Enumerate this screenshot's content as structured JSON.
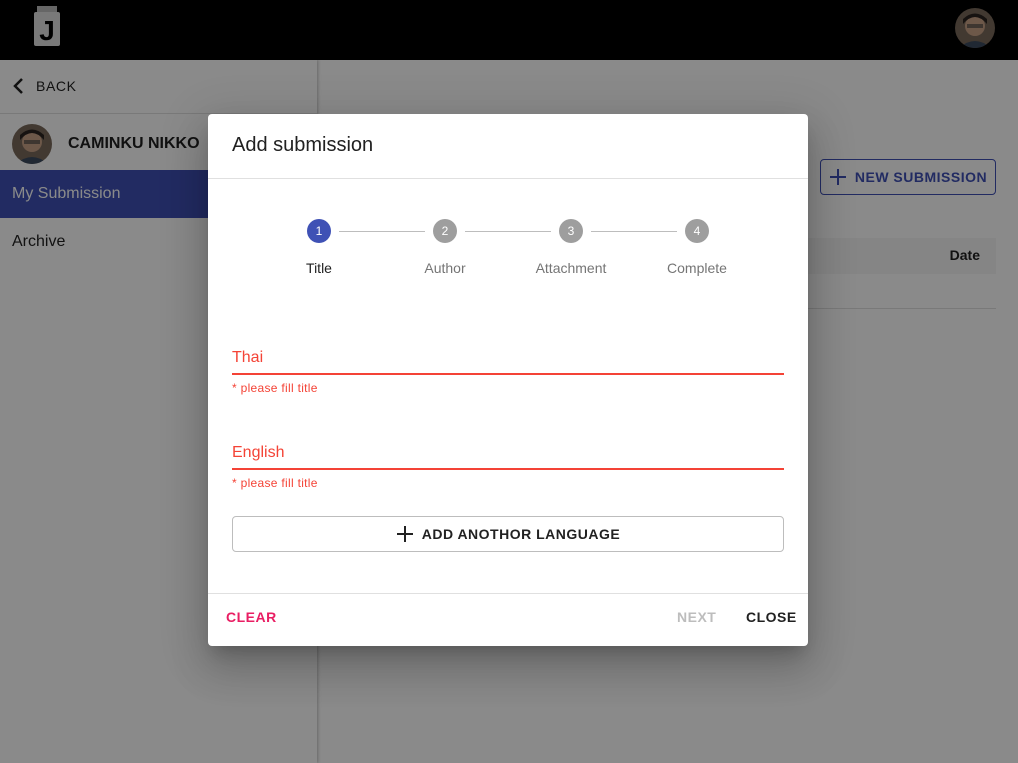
{
  "topbar": {
    "logo_letter": "J",
    "avatar_icon": "user-avatar-icon"
  },
  "sidebar": {
    "back_label": "BACK",
    "user_name": "CAMINKU NIKKO",
    "items": [
      {
        "label": "My Submission",
        "active": true
      },
      {
        "label": "Archive",
        "active": false
      }
    ]
  },
  "main": {
    "new_submission_label": "NEW SUBMISSION",
    "table_columns": [
      "Date"
    ]
  },
  "dialog": {
    "title": "Add submission",
    "steps": [
      {
        "number": "1",
        "label": "Title",
        "active": true
      },
      {
        "number": "2",
        "label": "Author",
        "active": false
      },
      {
        "number": "3",
        "label": "Attachment",
        "active": false
      },
      {
        "number": "4",
        "label": "Complete",
        "active": false
      }
    ],
    "fields": [
      {
        "label": "Thai",
        "error": "* please fill title"
      },
      {
        "label": "English",
        "error": "* please fill title"
      }
    ],
    "add_language_label": "ADD ANOTHOR LANGUAGE",
    "actions": {
      "clear": "CLEAR",
      "next": "NEXT",
      "close": "CLOSE"
    }
  },
  "colors": {
    "primary": "#3f51b5",
    "error": "#f44336",
    "accent": "#e91e63",
    "disabled": "#bdbdbd"
  }
}
